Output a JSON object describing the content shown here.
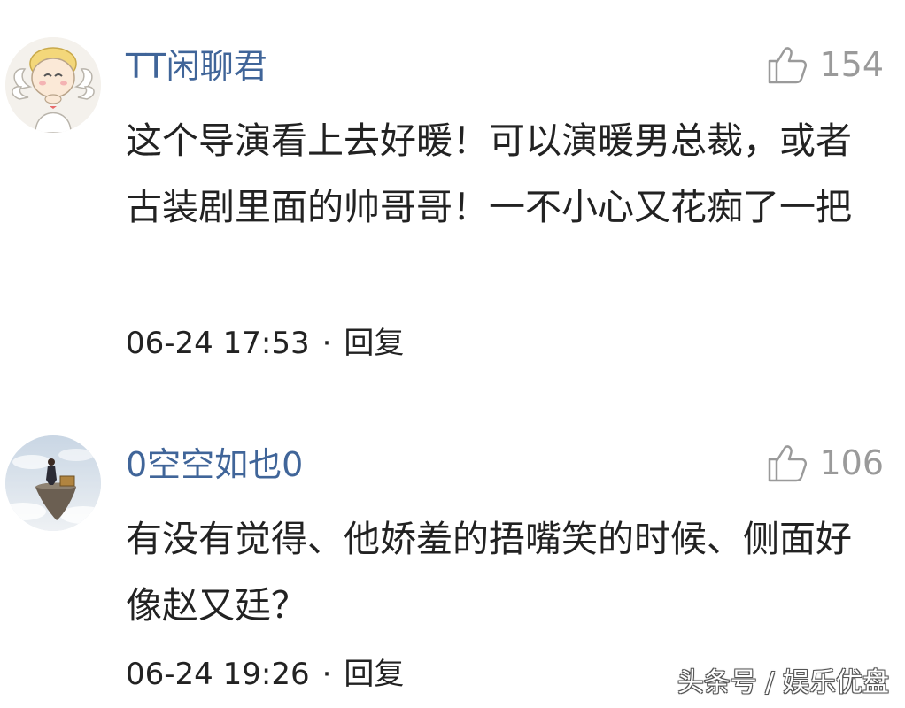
{
  "comments": [
    {
      "avatar_icon": "angel-avatar-icon",
      "username": "TT闲聊君",
      "like_icon": "thumbs-up-icon",
      "likes": "154",
      "text": "这个导演看上去好暖！可以演暖男总裁，或者古装剧里面的帅哥哥！一不小心又花痴了一把",
      "time": "06-24 17:53",
      "separator": "·",
      "reply_label": "回复"
    },
    {
      "avatar_icon": "floating-island-avatar-icon",
      "username": "0空空如也0",
      "like_icon": "thumbs-up-icon",
      "likes": "106",
      "text": "有没有觉得、他娇羞的捂嘴笑的时候、侧面好像赵又廷？",
      "time": "06-24 19:26",
      "separator": "·",
      "reply_label": "回复"
    }
  ],
  "watermark": "头条号 / 娱乐优盘",
  "colors": {
    "username": "#406599",
    "text": "#222222",
    "muted": "#9a9a9a",
    "background": "#ffffff"
  }
}
